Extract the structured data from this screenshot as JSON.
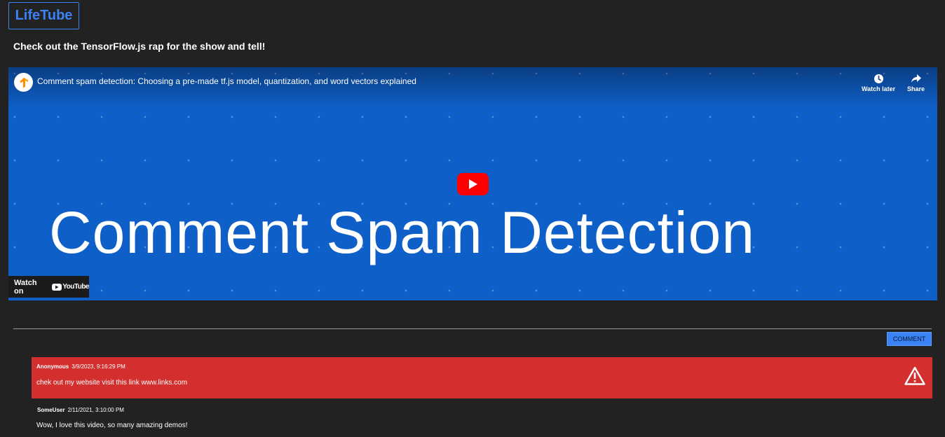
{
  "app": {
    "logo": "LifeTube"
  },
  "page": {
    "heading": "Check out the TensorFlow.js rap for the show and tell!"
  },
  "video": {
    "title": "Comment spam detection: Choosing a pre-made tf.js model, quantization, and word vectors explained",
    "big_title": "Comment Spam Detection",
    "watch_later_label": "Watch later",
    "share_label": "Share",
    "watch_on_label": "Watch on",
    "youtube_label": "YouTube",
    "icons": [
      "tensorflow-logo-icon",
      "clock-icon",
      "share-arrow-icon",
      "play-icon",
      "youtube-logo-icon"
    ],
    "colors": {
      "background": "#0f5fc9",
      "play": "#ff0000"
    }
  },
  "comments_section": {
    "comment_button_label": "COMMENT",
    "comments": [
      {
        "author": "Anonymous",
        "date": "3/9/2023, 9:16:29 PM",
        "text": "chek out my website visit this link www.links.com",
        "flagged_spam": true,
        "icon": "warning-icon"
      },
      {
        "author": "SomeUser",
        "date": "2/11/2021, 3:10:00 PM",
        "text": "Wow, I love this video, so many amazing demos!",
        "flagged_spam": false
      }
    ],
    "colors": {
      "spam_background": "#d32f2f",
      "button": "#3b82f6"
    }
  }
}
